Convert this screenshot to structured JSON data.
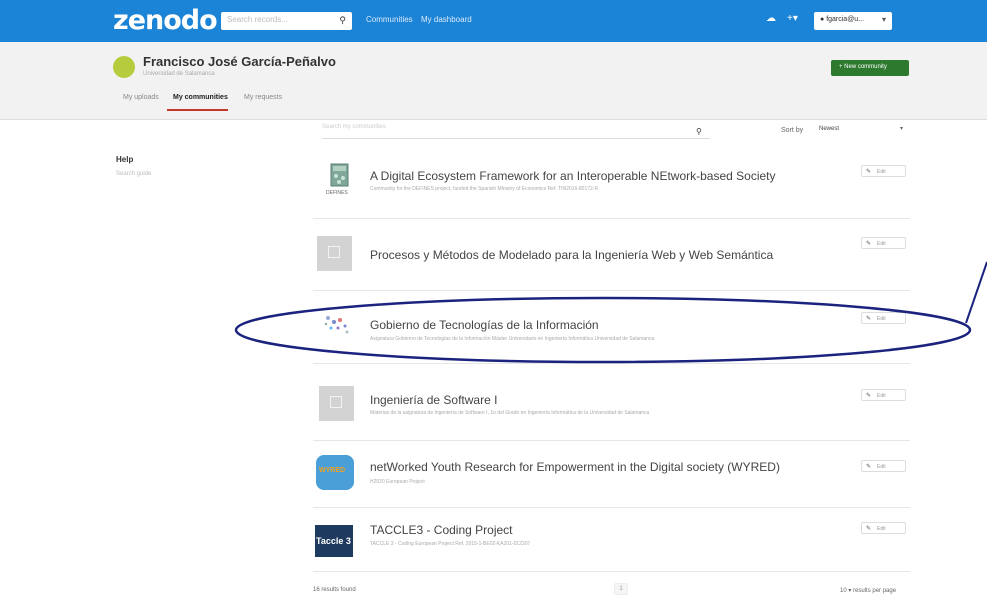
{
  "app": {
    "logo": "zenodo"
  },
  "topnav": {
    "search_placeholder": "Search records...",
    "links": [
      "Communities",
      "My dashboard"
    ],
    "upload_icon": "upload-icon",
    "add_icon": "plus-icon",
    "user_label": "fgarcia@u..."
  },
  "profile": {
    "name": "Francisco José García-Peñalvo",
    "subtitle": "Universidad de Salamanca",
    "new_community_label": "+ New community",
    "tabs": [
      "My uploads",
      "My communities",
      "My requests"
    ],
    "active_tab": "My communities"
  },
  "sidebar": {
    "help": "Help",
    "search_guide": "Search guide"
  },
  "toolbar": {
    "search_placeholder": "Search my communities",
    "sort_label": "Sort by",
    "sort_value": "Newest"
  },
  "communities": [
    {
      "title": "A Digital Ecosystem Framework for an Interoperable NEtwork-based Society",
      "desc": "Community for the DEFINES project, funded the Spanish Ministry of Economics Ref. TIN2016-80172-R",
      "thumb": "defines-logo",
      "thumb_label": "DEFINES",
      "edit": "Edit"
    },
    {
      "title": "Procesos y Métodos de Modelado para la Ingeniería Web y Web Semántica",
      "desc": "",
      "thumb": "image-placeholder-icon",
      "thumb_label": "",
      "edit": "Edit"
    },
    {
      "title": "Gobierno de Tecnologías de la Información",
      "desc": "Asignatura Gobierno de Tecnologías de la Información Máster Universitario en Ingeniería Informática Universidad de Salamanca",
      "thumb": "network-dots-logo",
      "thumb_label": "",
      "edit": "Edit"
    },
    {
      "title": "Ingeniería de Software I",
      "desc": "Materias de la asignatura de Ingeniería de Software I, 1o del Grado en Ingeniería Informática de la Universidad de Salamanca",
      "thumb": "image-placeholder-icon",
      "thumb_label": "",
      "edit": "Edit"
    },
    {
      "title": "netWorked Youth Research for Empowerment in the Digital society (WYRED)",
      "desc": "H2020 European Project",
      "thumb": "wyred-logo",
      "thumb_label": "WYRED",
      "edit": "Edit"
    },
    {
      "title": "TACCLE3 - Coding Project",
      "desc": "TACCLE 3 - Coding European Project Ref. 2015-1-BE02-KA201-012307",
      "thumb": "taccle3-logo",
      "thumb_label": "Taccle 3",
      "edit": "Edit"
    }
  ],
  "footer": {
    "count": "16 results found",
    "page": "1",
    "per_page": "10 ▾ results per page"
  },
  "colors": {
    "topbar": "#1c84d6",
    "new_community": "#2d7a2f",
    "annotation": "#1a237e"
  }
}
